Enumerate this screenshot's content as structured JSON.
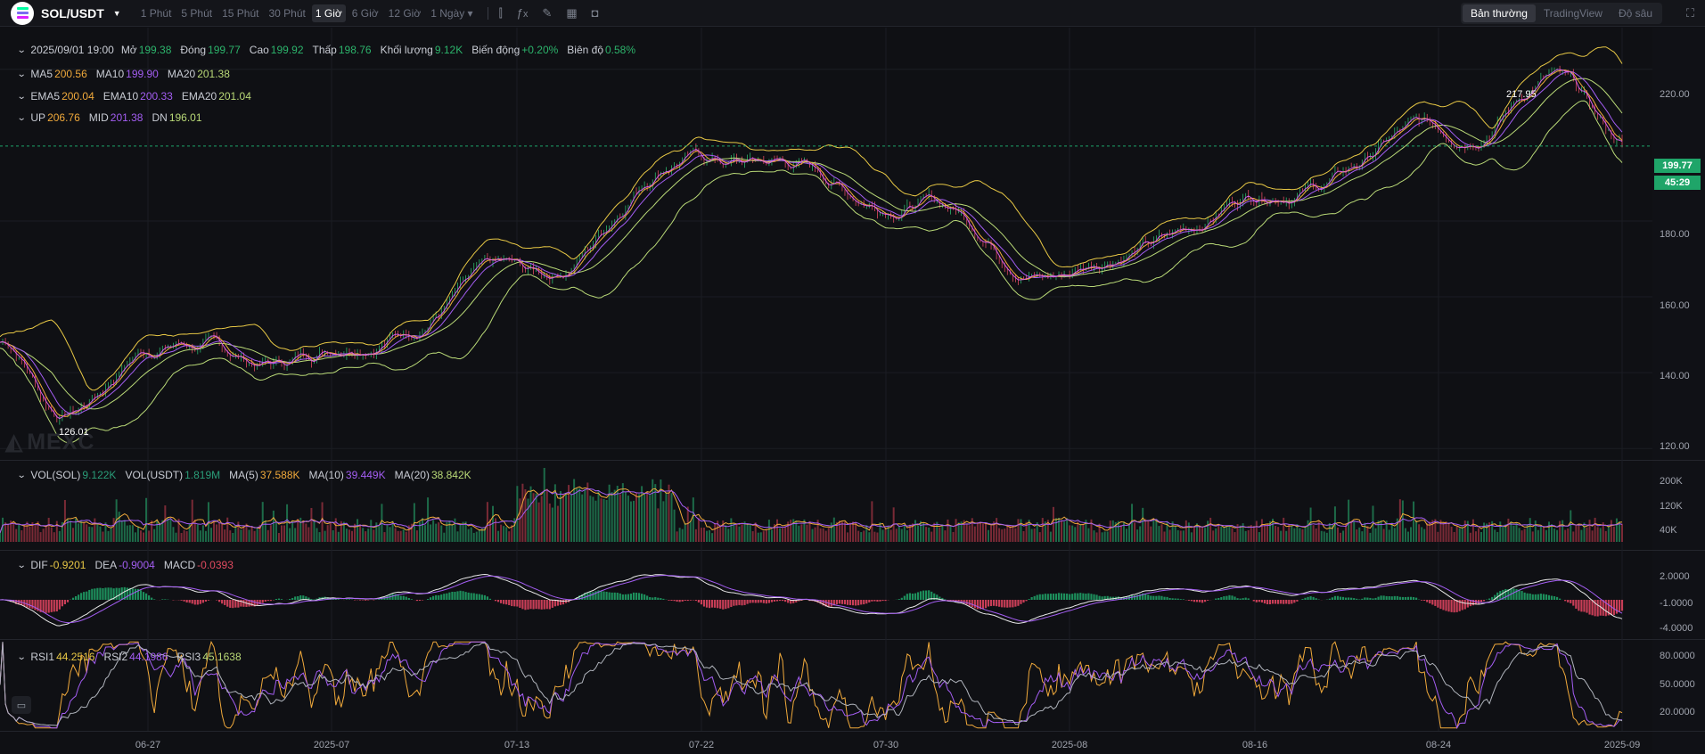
{
  "toolbar": {
    "symbol": "SOL/USDT",
    "intervals": [
      "1 Phút",
      "5 Phút",
      "15 Phút",
      "30 Phút",
      "1 Giờ",
      "6 Giờ",
      "12 Giờ",
      "1 Ngày ▾"
    ],
    "active_interval": "1 Giờ",
    "tools": [
      "candle-type-icon",
      "indicators-icon",
      "draw-icon",
      "layout-icon",
      "camera-icon"
    ],
    "views": [
      "Bản thường",
      "TradingView",
      "Độ sâu"
    ],
    "active_view": "Bản thường"
  },
  "legend": {
    "ohlc": {
      "time": "2025/09/01 19:00",
      "open_label": "Mở",
      "open": "199.38",
      "close_label": "Đóng",
      "close": "199.77",
      "high_label": "Cao",
      "high": "199.92",
      "low_label": "Thấp",
      "low": "198.76",
      "volume_label": "Khối lượng",
      "volume": "9.12K",
      "change_label": "Biến động",
      "change": "+0.20%",
      "amplitude_label": "Biên độ",
      "amplitude": "0.58%"
    },
    "ma": {
      "ma5_label": "MA5",
      "ma5": "200.56",
      "ma10_label": "MA10",
      "ma10": "199.90",
      "ma20_label": "MA20",
      "ma20": "201.38"
    },
    "ema": {
      "ema5_label": "EMA5",
      "ema5": "200.04",
      "ema10_label": "EMA10",
      "ema10": "200.33",
      "ema20_label": "EMA20",
      "ema20": "201.04"
    },
    "boll": {
      "up_label": "UP",
      "up": "206.76",
      "mid_label": "MID",
      "mid": "201.38",
      "dn_label": "DN",
      "dn": "196.01"
    },
    "vol": {
      "sol_label": "VOL(SOL)",
      "sol": "9.122K",
      "usdt_label": "VOL(USDT)",
      "usdt": "1.819M",
      "ma5_label": "MA(5)",
      "ma5": "37.588K",
      "ma10_label": "MA(10)",
      "ma10": "39.449K",
      "ma20_label": "MA(20)",
      "ma20": "38.842K"
    },
    "macd": {
      "dif_label": "DIF",
      "dif": "-0.9201",
      "dea_label": "DEA",
      "dea": "-0.9004",
      "macd_label": "MACD",
      "macd": "-0.0393"
    },
    "rsi": {
      "rsi1_label": "RSI1",
      "rsi1": "44.2516",
      "rsi2_label": "RSI2",
      "rsi2": "44.1986",
      "rsi3_label": "RSI3",
      "rsi3": "45.1638"
    }
  },
  "price_axis": [
    "220.00",
    "180.00",
    "160.00",
    "140.00",
    "120.00"
  ],
  "last_price": "199.77",
  "countdown": "45:29",
  "high_marker": "217.95",
  "low_marker": "126.01",
  "volume_axis": [
    "200K",
    "120K",
    "40K"
  ],
  "macd_axis": [
    "2.0000",
    "-1.0000",
    "-4.0000"
  ],
  "rsi_axis": [
    "80.0000",
    "50.0000",
    "20.0000"
  ],
  "time_axis": [
    "06-27",
    "2025-07",
    "07-13",
    "07-22",
    "07-30",
    "2025-08",
    "08-16",
    "08-24",
    "2025-09"
  ],
  "watermark": "MEXC",
  "colors": {
    "up": "#2cb36b",
    "down": "#e04a5f",
    "ma5": "#f0a93b",
    "ma10": "#a35df2",
    "ma20": "#b9d977"
  },
  "chart_data": {
    "type": "line",
    "title": "",
    "y_range": [
      117,
      231
    ],
    "x_range": [
      "06-27",
      "2025-09"
    ],
    "price_keypoints": [
      {
        "x": "start",
        "price": 148
      },
      {
        "x": "low",
        "price": 126.01
      },
      {
        "x": "06-27",
        "price": 145
      },
      {
        "x": "2025-07",
        "price": 148
      },
      {
        "x": "07-13",
        "price": 162
      },
      {
        "x": "07-22",
        "price": 201
      },
      {
        "x": "07-30",
        "price": 184
      },
      {
        "x": "2025-08",
        "price": 170
      },
      {
        "x": "08-16",
        "price": 183
      },
      {
        "x": "08-24",
        "price": 205
      },
      {
        "x": "high",
        "price": 217.95
      },
      {
        "x": "2025-09",
        "price": 199.77
      }
    ],
    "series": [
      {
        "name": "MA5"
      },
      {
        "name": "MA10"
      },
      {
        "name": "MA20"
      },
      {
        "name": "UP"
      },
      {
        "name": "DN"
      }
    ],
    "grid": true
  }
}
